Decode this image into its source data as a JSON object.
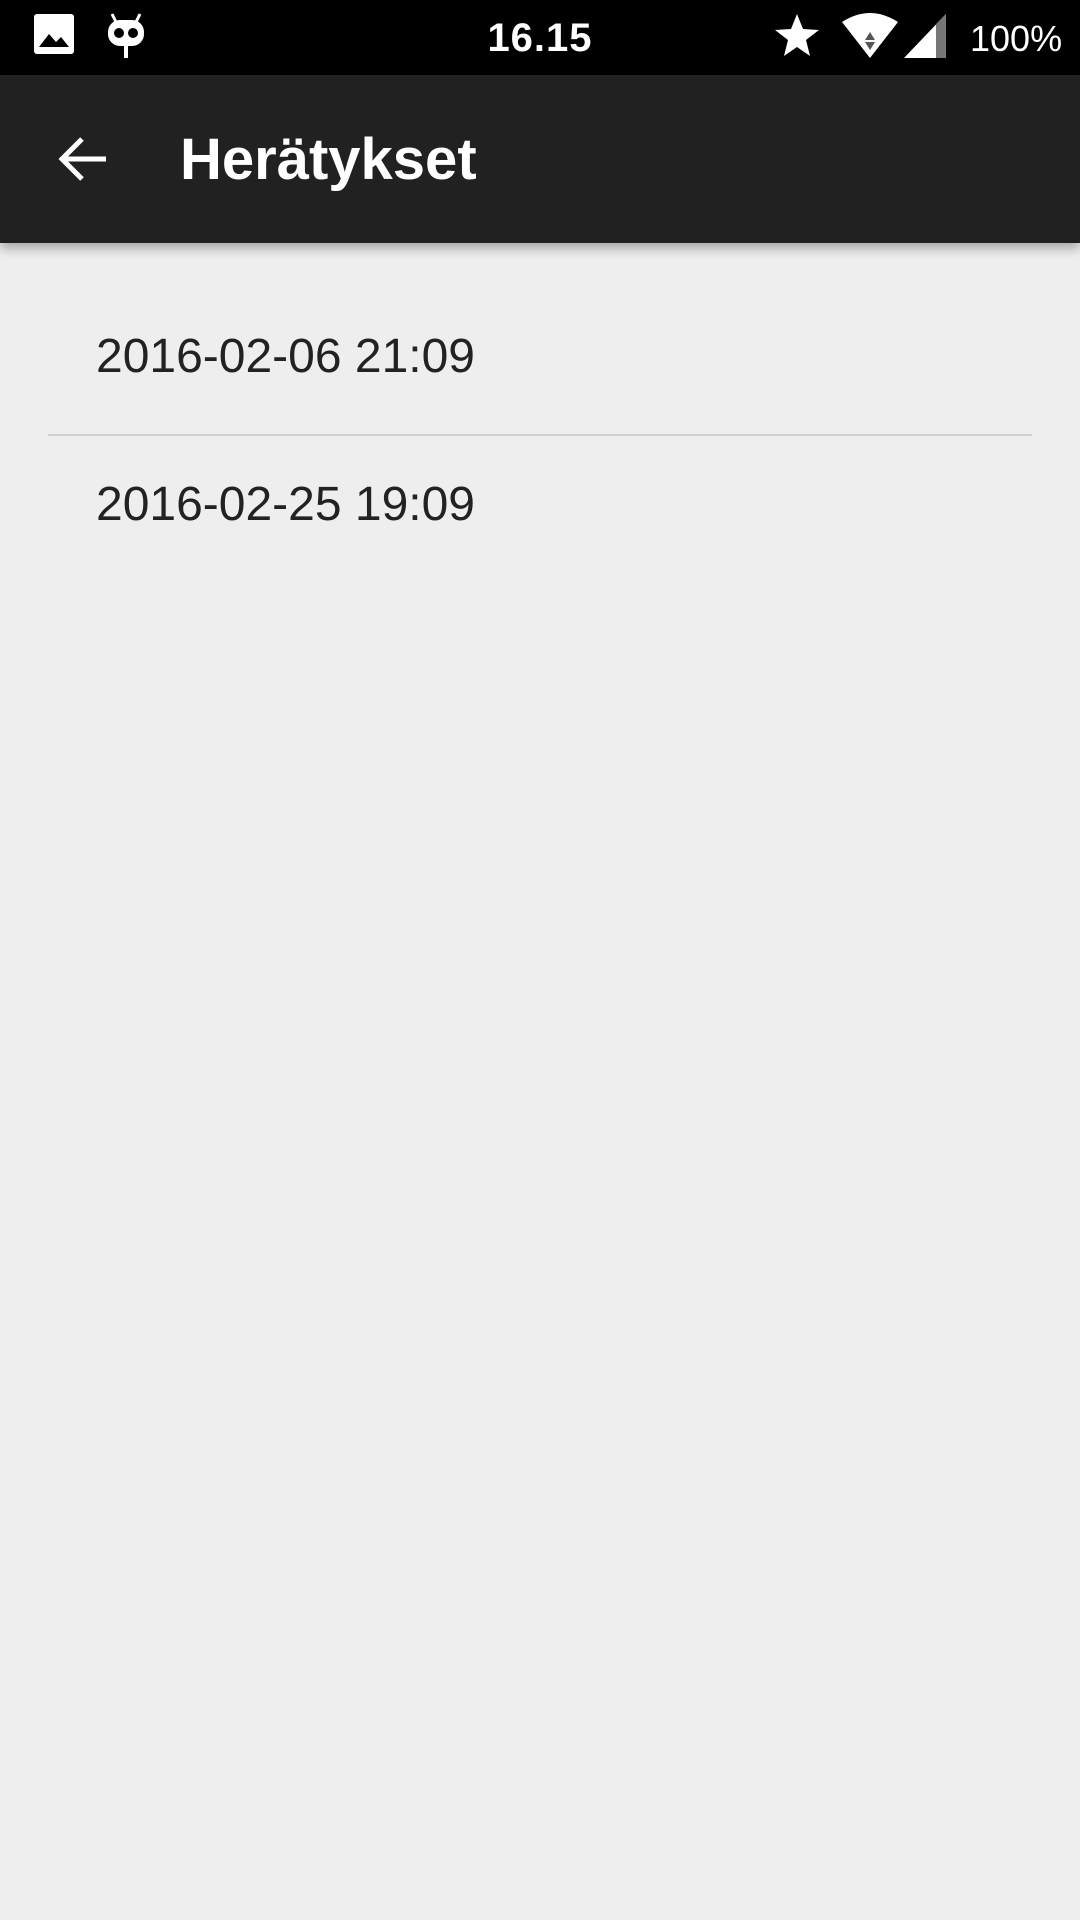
{
  "status_bar": {
    "time": "16.15",
    "battery": "100%",
    "icons": [
      "gallery-icon",
      "cyanogen-mascot-icon",
      "star-icon",
      "wifi-icon",
      "signal-icon"
    ]
  },
  "app_bar": {
    "title": "Herätykset",
    "back_icon": "arrow-left-icon"
  },
  "alarms": [
    {
      "datetime": "2016-02-06 21:09"
    },
    {
      "datetime": "2016-02-25 19:09"
    }
  ],
  "colors": {
    "status_bar": "#000000",
    "app_bar": "#212121",
    "background": "#eeeeee",
    "text": "#222222",
    "divider": "#cfcfcf"
  }
}
